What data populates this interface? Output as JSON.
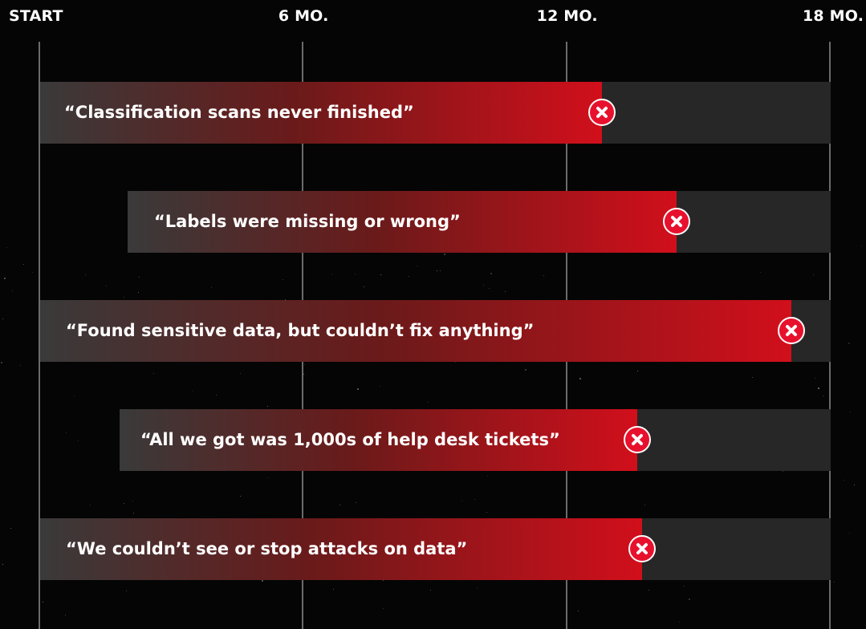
{
  "colors": {
    "background": "#050505",
    "track": "#272727",
    "fill_start": "#3a3a3a",
    "fill_end": "#d10f1b",
    "fail_icon": "#e8112d",
    "gridline": "#6b6b6b",
    "text": "#ffffff"
  },
  "chart_data": {
    "type": "bar",
    "orientation": "horizontal",
    "title": "",
    "xlabel": "",
    "ylabel": "",
    "x_unit": "months",
    "xlim": [
      0,
      18
    ],
    "grid": true,
    "ticks": [
      {
        "value": 0,
        "label": "START"
      },
      {
        "value": 6,
        "label": "6 MO."
      },
      {
        "value": 12,
        "label": "12 MO."
      },
      {
        "value": 18,
        "label": "18 MO."
      }
    ],
    "bars": [
      {
        "label": "“Classification scans never finished”",
        "start": 0,
        "end": 12.8,
        "icon": "x-circle-icon"
      },
      {
        "label": "“Labels were missing or wrong”",
        "start": 2,
        "end": 14.5,
        "icon": "x-circle-icon"
      },
      {
        "label": "“Found sensitive data, but couldn’t fix anything”",
        "start": 0,
        "end": 17.1,
        "icon": "x-circle-icon"
      },
      {
        "label": "“All we got was 1,000s of help desk tickets”",
        "start": 1.8,
        "end": 13.6,
        "icon": "x-circle-icon"
      },
      {
        "label": "“We couldn’t see or stop attacks on data”",
        "start": 0,
        "end": 13.7,
        "icon": "x-circle-icon"
      }
    ]
  }
}
